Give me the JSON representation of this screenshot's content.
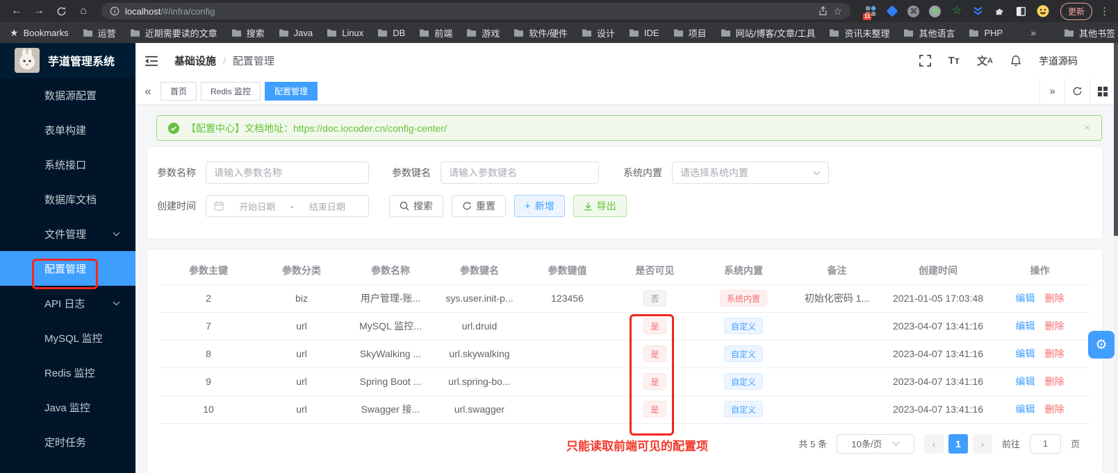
{
  "browser": {
    "url_host": "localhost",
    "url_path": "/#/infra/config",
    "extension_badge": "11",
    "update_button": "更新",
    "bookmarks_label": "Bookmarks",
    "bookmarks": [
      "运营",
      "近期需要读的文章",
      "搜索",
      "Java",
      "Linux",
      "DB",
      "前端",
      "游戏",
      "软件/硬件",
      "设计",
      "IDE",
      "项目",
      "网站/博客/文章/工具",
      "资讯未整理",
      "其他语言",
      "PHP"
    ],
    "other_bookmarks": "其他书签"
  },
  "sidebar": {
    "app_title": "芋道管理系统",
    "items": [
      {
        "label": "数据源配置"
      },
      {
        "label": "表单构建"
      },
      {
        "label": "系统接口"
      },
      {
        "label": "数据库文档"
      },
      {
        "label": "文件管理"
      },
      {
        "label": "配置管理"
      },
      {
        "label": "API 日志"
      },
      {
        "label": "MySQL 监控"
      },
      {
        "label": "Redis 监控"
      },
      {
        "label": "Java 监控"
      },
      {
        "label": "定时任务"
      }
    ]
  },
  "header": {
    "breadcrumb_parent": "基础设施",
    "breadcrumb_current": "配置管理",
    "username": "芋道源码"
  },
  "tabs": [
    {
      "label": "首页"
    },
    {
      "label": "Redis 监控"
    },
    {
      "label": "配置管理"
    }
  ],
  "alert": {
    "prefix": "【配置中心】文档地址：",
    "link": "https://doc.iocoder.cn/config-center/"
  },
  "filters": {
    "name_label": "参数名称",
    "name_placeholder": "请输入参数名称",
    "key_label": "参数键名",
    "key_placeholder": "请输入参数键名",
    "builtin_label": "系统内置",
    "builtin_placeholder": "请选择系统内置",
    "time_label": "创建时间",
    "date_start": "开始日期",
    "date_sep": "-",
    "date_end": "结束日期",
    "search": "搜索",
    "reset": "重置",
    "create": "新增",
    "export": "导出"
  },
  "table": {
    "columns": [
      "参数主键",
      "参数分类",
      "参数名称",
      "参数键名",
      "参数键值",
      "是否可见",
      "系统内置",
      "备注",
      "创建时间",
      "操作"
    ],
    "edit": "编辑",
    "delete": "删除",
    "rows": [
      {
        "id": "2",
        "category": "biz",
        "name": "用户管理-账...",
        "key": "sys.user.init-p...",
        "value": "123456",
        "visible": "否",
        "builtin": "系统内置",
        "remark": "初始化密码 1...",
        "created": "2021-01-05 17:03:48"
      },
      {
        "id": "7",
        "category": "url",
        "name": "MySQL 监控...",
        "key": "url.druid",
        "value": "",
        "visible": "是",
        "builtin": "自定义",
        "remark": "",
        "created": "2023-04-07 13:41:16"
      },
      {
        "id": "8",
        "category": "url",
        "name": "SkyWalking ...",
        "key": "url.skywalking",
        "value": "",
        "visible": "是",
        "builtin": "自定义",
        "remark": "",
        "created": "2023-04-07 13:41:16"
      },
      {
        "id": "9",
        "category": "url",
        "name": "Spring Boot ...",
        "key": "url.spring-bo...",
        "value": "",
        "visible": "是",
        "builtin": "自定义",
        "remark": "",
        "created": "2023-04-07 13:41:16"
      },
      {
        "id": "10",
        "category": "url",
        "name": "Swagger 接...",
        "key": "url.swagger",
        "value": "",
        "visible": "是",
        "builtin": "自定义",
        "remark": "",
        "created": "2023-04-07 13:41:16"
      }
    ]
  },
  "pagination": {
    "total": "共 5 条",
    "page_size": "10条/页",
    "current_page": "1",
    "goto_label": "前往",
    "goto_value": "1",
    "page_unit": "页"
  },
  "annotation": {
    "note": "只能读取前端可见的配置项"
  },
  "colors": {
    "accent": "#409eff",
    "danger": "#f56c6c",
    "success": "#67c23a",
    "sidebar_bg": "#001529",
    "annotation_red": "#f2271c"
  }
}
